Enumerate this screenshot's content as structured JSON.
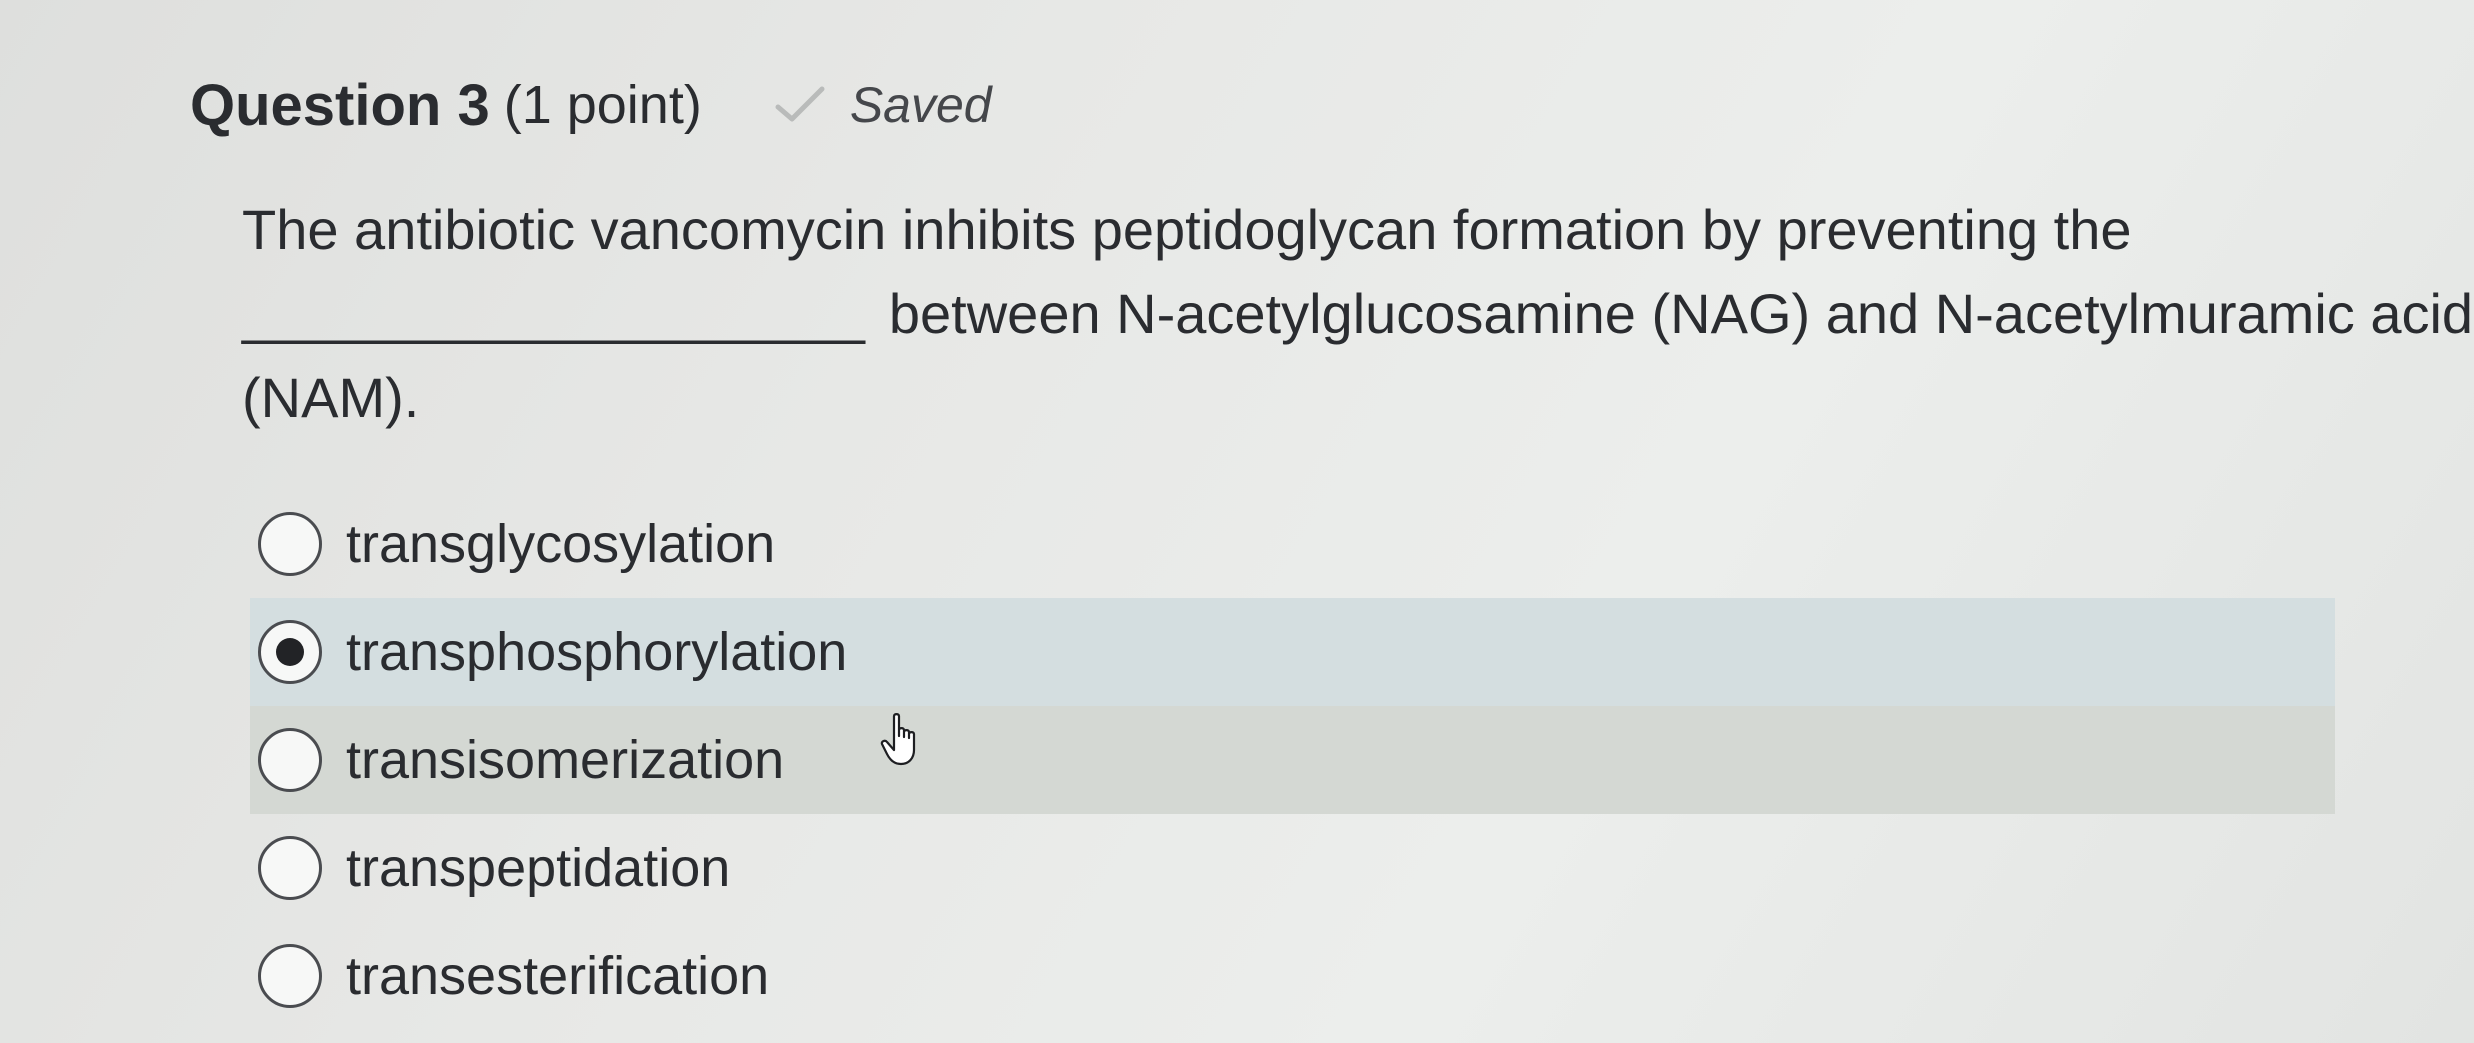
{
  "question": {
    "title": "Question 3",
    "points": "(1 point)",
    "status_label": "Saved",
    "status_icon": "check-icon",
    "text_lines": [
      "The antibiotic vancomycin inhibits peptidoglycan formation by preventing the",
      "between N-acetylglucosamine (NAG) and N-acetylmuramic acid",
      "(NAM)."
    ],
    "blank": "____________________"
  },
  "options": [
    {
      "label": "transglycosylation",
      "selected": false
    },
    {
      "label": "transphosphorylation",
      "selected": true
    },
    {
      "label": "transisomerization",
      "selected": false
    },
    {
      "label": "transpeptidation",
      "selected": false
    },
    {
      "label": "transesterification",
      "selected": false
    }
  ],
  "cursor_icon": "pointer-hand-icon",
  "colors": {
    "selected_row": "#d4dee0",
    "hover_row": "#d4d8d3",
    "text": "#2a2c30"
  }
}
